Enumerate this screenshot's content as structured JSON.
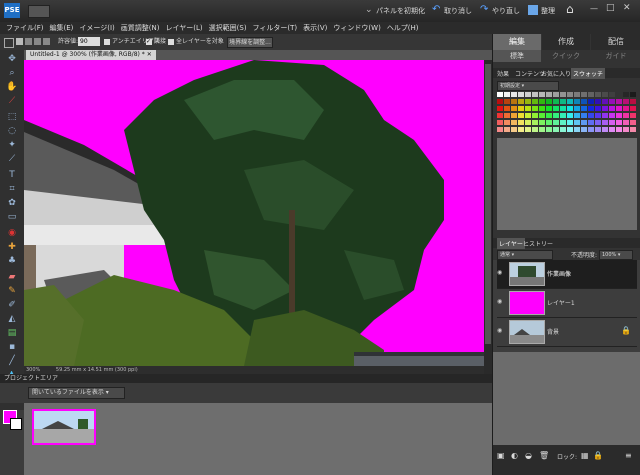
{
  "topbar": {
    "panel_reset": "パネルを初期化",
    "undo": "取り消し",
    "redo": "やり直し",
    "organizer": "整理"
  },
  "menu": [
    "ファイル(F)",
    "編集(E)",
    "イメージ(I)",
    "画質調整(N)",
    "レイヤー(L)",
    "選択範囲(S)",
    "フィルター(T)",
    "表示(V)",
    "ウィンドウ(W)",
    "ヘルプ(H)"
  ],
  "options": {
    "tolerance_label": "許容値:",
    "tolerance_value": "90",
    "antialias": "アンチエイリアス",
    "contiguous": "隣接",
    "all_layers": "全レイヤーを対象",
    "refine_edge": "境界線を調整..."
  },
  "document": {
    "tab_title": "Untitled-1 @ 300% (作業画像, RGB/8) *",
    "zoom": "300%",
    "status": "59.25 mm x 14.51 mm (300 ppi)"
  },
  "project_bin": {
    "header": "プロジェクトエリア",
    "selector": "開いているファイルを表示"
  },
  "right_panel": {
    "tabs": [
      "編集",
      "作成",
      "配信"
    ],
    "subtabs": [
      "標準",
      "クイック",
      "ガイド"
    ],
    "palette_tabs": [
      "効果",
      "コンテンツ",
      "お気に入り",
      "スウォッチ"
    ],
    "swatch_set": "初期設定",
    "layers_tabs": [
      "レイヤー",
      "ヒストリー"
    ],
    "blend_mode": "通常",
    "opacity_label": "不透明度:",
    "opacity_value": "100%",
    "layers": [
      {
        "name": "作業画像"
      },
      {
        "name": "レイヤー1"
      },
      {
        "name": "背景"
      }
    ],
    "lock_label": "ロック:"
  },
  "colors": {
    "magenta": "#ff00ff",
    "canvas_bg": "#ff00ff",
    "tree_dark": "#1d3a1d"
  }
}
